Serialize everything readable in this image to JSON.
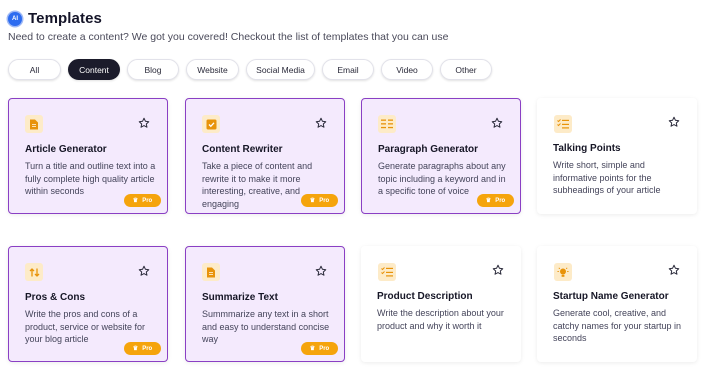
{
  "header": {
    "badge": "AI",
    "title": "Templates",
    "subtitle": "Need to create a content? We got you covered! Checkout the list of templates that you can use"
  },
  "tabs": [
    {
      "label": "All",
      "active": false
    },
    {
      "label": "Content",
      "active": true
    },
    {
      "label": "Blog",
      "active": false
    },
    {
      "label": "Website",
      "active": false
    },
    {
      "label": "Social Media",
      "active": false
    },
    {
      "label": "Email",
      "active": false
    },
    {
      "label": "Video",
      "active": false
    },
    {
      "label": "Other",
      "active": false
    }
  ],
  "cards": [
    {
      "title": "Article Generator",
      "description": "Turn a title and outline text into a fully complete high quality article within seconds",
      "icon": "document-icon",
      "pro": true
    },
    {
      "title": "Content Rewriter",
      "description": "Take a piece of content and rewrite it to make it more interesting, creative, and engaging",
      "icon": "checkbox-icon",
      "pro": true
    },
    {
      "title": "Paragraph Generator",
      "description": "Generate paragraphs about any topic including a keyword and in a specific tone of voice",
      "icon": "paragraph-icon",
      "pro": true
    },
    {
      "title": "Talking Points",
      "description": "Write short, simple and informative points for the subheadings of your article",
      "icon": "checklist-icon",
      "pro": false
    },
    {
      "title": "Pros & Cons",
      "description": "Write the pros and cons of a product, service or website for your blog article",
      "icon": "swap-icon",
      "pro": true
    },
    {
      "title": "Summarize Text",
      "description": "Summmarize any text in a short and easy to understand concise way",
      "icon": "document-icon",
      "pro": true
    },
    {
      "title": "Product Description",
      "description": "Write the description about your product and why it worth it",
      "icon": "checklist-icon",
      "pro": false
    },
    {
      "title": "Startup Name Generator",
      "description": "Generate cool, creative, and catchy names for your startup in seconds",
      "icon": "lightbulb-icon",
      "pro": false
    }
  ],
  "pro_label": "Pro",
  "colors": {
    "accent_purple": "#8a3fc4",
    "pro_card_bg": "#f4eafd",
    "pro_badge": "#f5a40c",
    "icon_orange": "#e8930a",
    "active_tab": "#1b1b2b"
  }
}
